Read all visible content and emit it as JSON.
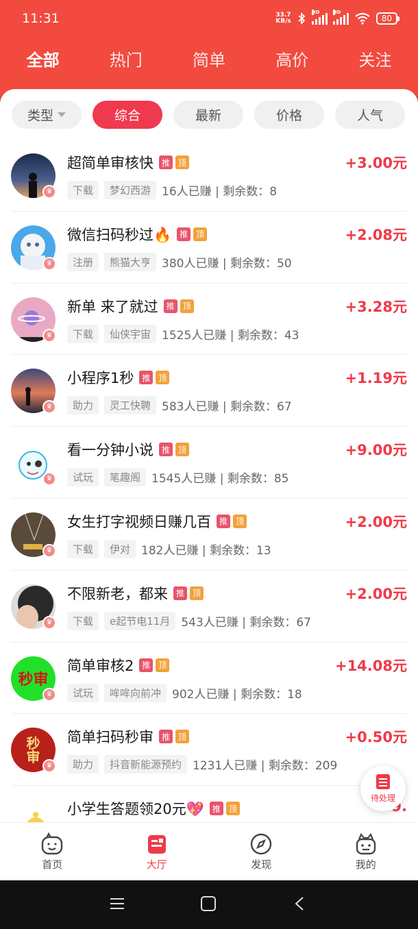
{
  "status_bar": {
    "time": "11:31",
    "net_speed_value": "33.7",
    "net_speed_unit": "KB/s",
    "hd1": "HD",
    "hd2": "HD",
    "battery": "80"
  },
  "top_tabs": [
    {
      "label": "全部",
      "active": true
    },
    {
      "label": "热门",
      "active": false
    },
    {
      "label": "简单",
      "active": false
    },
    {
      "label": "高价",
      "active": false
    },
    {
      "label": "关注",
      "active": false
    }
  ],
  "filters": [
    {
      "label": "类型",
      "active": false,
      "dropdown": true
    },
    {
      "label": "综合",
      "active": true
    },
    {
      "label": "最新",
      "active": false
    },
    {
      "label": "价格",
      "active": false
    },
    {
      "label": "人气",
      "active": false
    }
  ],
  "badges": {
    "recommend": "推",
    "top": "顶"
  },
  "tasks": [
    {
      "title": "超简单审核快",
      "price": "+3.00元",
      "type": "下载",
      "app": "梦幻西游",
      "stats": "16人已赚 | 剩余数：8"
    },
    {
      "title": "微信扫码秒过🔥",
      "price": "+2.08元",
      "type": "注册",
      "app": "熊猫大亨",
      "stats": "380人已赚 | 剩余数：50"
    },
    {
      "title": "新单 来了就过",
      "price": "+3.28元",
      "type": "下载",
      "app": "仙侠宇宙",
      "stats": "1525人已赚 | 剩余数：43"
    },
    {
      "title": "小程序1秒",
      "price": "+1.19元",
      "type": "助力",
      "app": "灵工快聘",
      "stats": "583人已赚 | 剩余数：67"
    },
    {
      "title": "看一分钟小说",
      "price": "+9.00元",
      "type": "试玩",
      "app": "笔趣阁",
      "stats": "1545人已赚 | 剩余数：85"
    },
    {
      "title": "女生打字视频日赚几百",
      "price": "+2.00元",
      "type": "下载",
      "app": "伊对",
      "stats": "182人已赚 | 剩余数：13"
    },
    {
      "title": "不限新老，都来",
      "price": "+2.00元",
      "type": "下载",
      "app": "e起节电11月",
      "stats": "543人已赚 | 剩余数：67"
    },
    {
      "title": "简单审核2",
      "price": "+14.08元",
      "type": "试玩",
      "app": "哞哞向前冲",
      "stats": "902人已赚 | 剩余数：18"
    },
    {
      "title": "简单扫码秒审",
      "price": "+0.50元",
      "type": "助力",
      "app": "抖音新能源预约",
      "stats": "1231人已赚 | 剩余数：209"
    },
    {
      "title": "小学生答题领20元💖",
      "price": "+9.",
      "type": "",
      "app": "",
      "stats": ""
    }
  ],
  "avatar_text": {
    "row8": "秒审",
    "row9": "秒审"
  },
  "floating_button": {
    "label": "待处理",
    "icon": "list-icon"
  },
  "bottom_nav": [
    {
      "label": "首页",
      "icon": "smile-home-icon",
      "active": false
    },
    {
      "label": "大厅",
      "icon": "hall-icon",
      "active": true
    },
    {
      "label": "发现",
      "icon": "compass-icon",
      "active": false
    },
    {
      "label": "我的",
      "icon": "robot-profile-icon",
      "active": false
    }
  ],
  "colors": {
    "header": "#f24a3e",
    "accent": "#f0394f",
    "price": "#ee3a48"
  }
}
